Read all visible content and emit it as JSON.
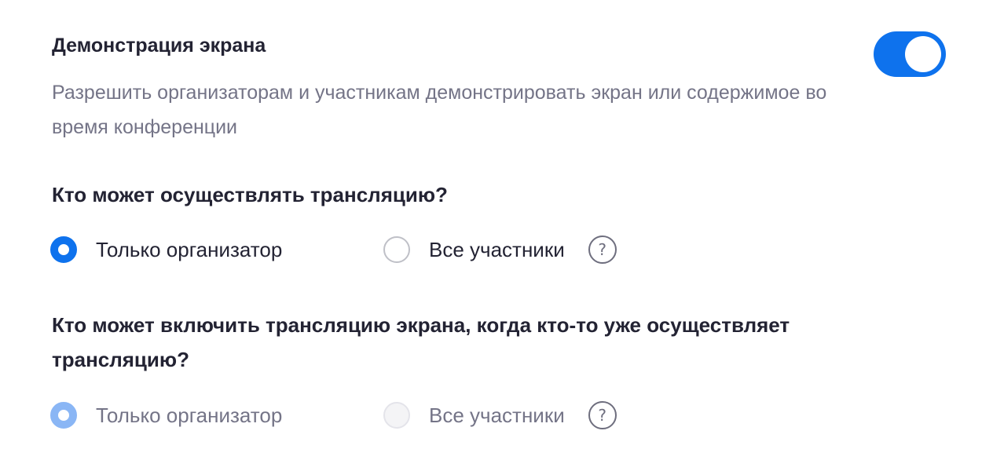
{
  "setting": {
    "title": "Демонстрация экрана",
    "description": "Разрешить организаторам и участникам демонстрировать экран или содержимое во время конференции",
    "toggle_on": true,
    "accent_color": "#0e72ed"
  },
  "question1": {
    "text": "Кто может осуществлять трансляцию?",
    "options": [
      {
        "label": "Только организатор",
        "selected": true
      },
      {
        "label": "Все участники",
        "selected": false
      }
    ],
    "help_icon": "?"
  },
  "question2": {
    "text": "Кто может включить трансляцию экрана, когда кто-то уже осуществляет трансляцию?",
    "disabled": true,
    "options": [
      {
        "label": "Только организатор",
        "selected": true
      },
      {
        "label": "Все участники",
        "selected": false
      }
    ],
    "help_icon": "?"
  }
}
